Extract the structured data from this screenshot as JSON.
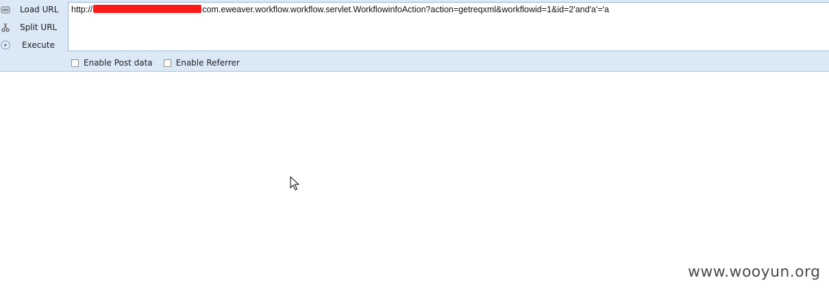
{
  "sidebar": {
    "load_url": "Load URL",
    "split_url": "Split URL",
    "execute": "Execute"
  },
  "url": {
    "prefix": "http://",
    "suffix": "com.eweaver.workflow.workflow.servlet.WorkflowinfoAction?action=getreqxml&workflowid=1&id=2'and'a'='a"
  },
  "options": {
    "post_data": "Enable Post data",
    "referrer": "Enable Referrer"
  },
  "watermark": "www.wooyun.org",
  "colors": {
    "toolbar_bg": "#dbe8f6",
    "redaction": "#ff1a1a"
  }
}
